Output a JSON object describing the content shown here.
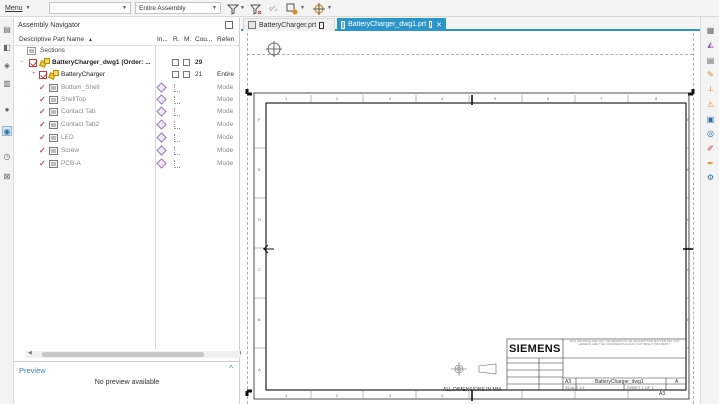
{
  "toolbar": {
    "menu_label": "Menu",
    "filter_value": "",
    "scope_value": "Entire Assembly"
  },
  "navigator": {
    "title": "Assembly Navigator",
    "columns": {
      "part_name": "Descriptive Part Name",
      "info": "In...",
      "read_only": "R.",
      "modified": "M.",
      "count": "Cou...",
      "reference": "Refen"
    },
    "sections_label": "Sections",
    "rows": [
      {
        "name": "BatteryCharger_dwg1 (Order: ...",
        "count": "29",
        "reference": "",
        "kind": "root"
      },
      {
        "name": "BatteryCharger",
        "count": "21",
        "reference": "Entire",
        "kind": "subassembly"
      },
      {
        "name": "Bottom_Shell",
        "count": "",
        "reference": "Mode",
        "kind": "part"
      },
      {
        "name": "ShellTop",
        "count": "",
        "reference": "Mode",
        "kind": "part"
      },
      {
        "name": "Contact Tab",
        "count": "",
        "reference": "Mode",
        "kind": "part"
      },
      {
        "name": "Contact Tab2",
        "count": "",
        "reference": "Mode",
        "kind": "part"
      },
      {
        "name": "LED",
        "count": "",
        "reference": "Mode",
        "kind": "part"
      },
      {
        "name": "Screw",
        "count": "",
        "reference": "Mode",
        "kind": "part"
      },
      {
        "name": "PCB-A",
        "count": "",
        "reference": "Mode",
        "kind": "part"
      }
    ],
    "preview_title": "Preview",
    "preview_empty": "No preview available"
  },
  "tabs": [
    {
      "label": "BatteryCharger.prt",
      "active": false
    },
    {
      "label": "BatteryCharger_dwg1.prt",
      "active": true
    }
  ],
  "drawing": {
    "title_block": {
      "company": "SIEMENS",
      "disclaimer": "THIS DRAWING AND ANY INFORMATION OR DESCRIPTIVE MATTER SET OUT HEREON ARE THE CONFIDENTIAL AND COPYRIGHT PROPERTY",
      "size": "A3",
      "drawing_name": "BatteryCharger_dwg1",
      "revision": "A",
      "scale": "SCALE 1:1",
      "sheet": "SHEET 1 OF 1",
      "sheet_code": "A3"
    },
    "dimensions_note": "ALL DIMENSIONS IN MM",
    "row_letters": [
      "F",
      "E",
      "D",
      "C",
      "B",
      "A"
    ],
    "column_numbers": [
      "1",
      "2",
      "3",
      "4",
      "5",
      "6",
      "7",
      "8"
    ]
  },
  "colors": {
    "accent": "#2d96c9",
    "check_red": "#c23b3b",
    "grey_text": "#8a8a8a"
  }
}
